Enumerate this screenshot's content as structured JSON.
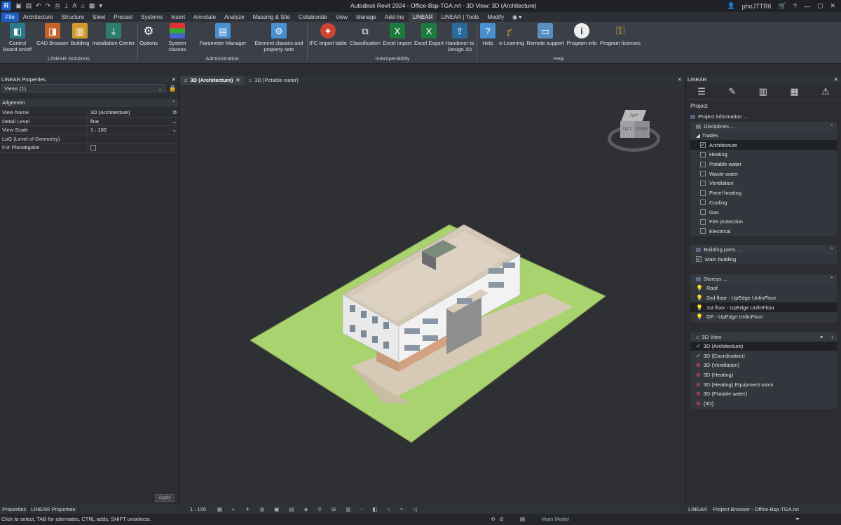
{
  "window": {
    "title": "Autodesk Revit 2024 - Office-Bsp-TGA.rvt - 3D View: 3D (Architecture)",
    "user": "phoJTTR6"
  },
  "ribbon": {
    "tabs": [
      "File",
      "Architecture",
      "Structure",
      "Steel",
      "Precast",
      "Systems",
      "Insert",
      "Annotate",
      "Analyze",
      "Massing & Site",
      "Collaborate",
      "View",
      "Manage",
      "Add-Ins",
      "LINEAR",
      "LINEAR | Tools",
      "Modify"
    ],
    "active_tab": "LINEAR",
    "buttons": {
      "control_board": "Control Board on/off",
      "cad_browser": "CAD Browser",
      "building": "Building",
      "installation_center": "Installation Center",
      "options": "Options",
      "system_classes": "System classes",
      "parameter_manager": "Parameter Manager",
      "element_classes": "Element classes and property sets",
      "ifc_import": "IFC Import table",
      "classification": "Classification",
      "excel_import": "Excel Import",
      "excel_export": "Excel Export",
      "handover": "Handover to Design 3D",
      "help": "Help",
      "elearning": "e-Learning",
      "remote_support": "Remote support",
      "program_info": "Program info",
      "program_licenses": "Program licenses"
    },
    "groups": {
      "linear_solutions": "LINEAR Solutions",
      "administration": "Administration",
      "interoperability": "Interoperability",
      "help": "Help"
    }
  },
  "properties": {
    "title": "LINEAR Properties",
    "selector": "Views (1)",
    "section": "Allgemein",
    "rows": [
      {
        "key": "View Name",
        "value": "3D (Architecture)"
      },
      {
        "key": "Detail Level",
        "value": "fine"
      },
      {
        "key": "View Scale",
        "value": "1 : 100"
      },
      {
        "key": "LoG (Level of Geometry)",
        "value": ""
      },
      {
        "key": "Für Planabgabe",
        "value": ""
      }
    ],
    "apply": "Apply",
    "bottom_tabs": [
      "Properties",
      "LINEAR Properties"
    ]
  },
  "view_tabs": [
    {
      "label": "3D (Architecture)",
      "active": true
    },
    {
      "label": "3D (Potable water)",
      "active": false
    }
  ],
  "view_control": {
    "scale": "1 : 100"
  },
  "linear_panel": {
    "title": "LINEAR",
    "project_heading": "Project",
    "project_information": "Project information ...",
    "disciplines": "Disciplines ...",
    "trades_label": "Trades",
    "trades": [
      {
        "name": "Architecture",
        "checked": true
      },
      {
        "name": "Heating",
        "checked": false
      },
      {
        "name": "Potable water",
        "checked": false
      },
      {
        "name": "Waste water",
        "checked": false
      },
      {
        "name": "Ventilation",
        "checked": false
      },
      {
        "name": "Panel heating",
        "checked": false
      },
      {
        "name": "Cooling",
        "checked": false
      },
      {
        "name": "Gas",
        "checked": false
      },
      {
        "name": "Fire protection",
        "checked": false
      },
      {
        "name": "Electrical",
        "checked": false
      }
    ],
    "building_parts": "Building parts ...",
    "main_building": "Main building",
    "storeys": "Storeys ...",
    "storey_list": [
      "Roof",
      "2nd floor - UpEdge UnfinFloor",
      "1st floor - UpEdge UnfinFloor",
      "GF - UpEdge UnfinFloor"
    ],
    "view3d": "3D View",
    "views": [
      {
        "name": "3D (Architecture)",
        "ok": true
      },
      {
        "name": "3D (Coordination)",
        "ok": true
      },
      {
        "name": "3D (Ventilation)",
        "ok": false
      },
      {
        "name": "3D (Heating)",
        "ok": false
      },
      {
        "name": "3D (Heating) Equipment room",
        "ok": false
      },
      {
        "name": "3D (Potable water)",
        "ok": false
      },
      {
        "name": "{3D}",
        "ok": false
      }
    ],
    "bottom_tabs": [
      "LINEAR",
      "Project Browser - Office-Bsp-TGA.rvt"
    ]
  },
  "viewcube": {
    "top": "TOP",
    "left": "LEFT",
    "front": "FRONT"
  },
  "statusbar": {
    "hint": "Click to select, TAB for alternates, CTRL adds, SHIFT unselects.",
    "model": "Main Model",
    "count": ":0"
  }
}
